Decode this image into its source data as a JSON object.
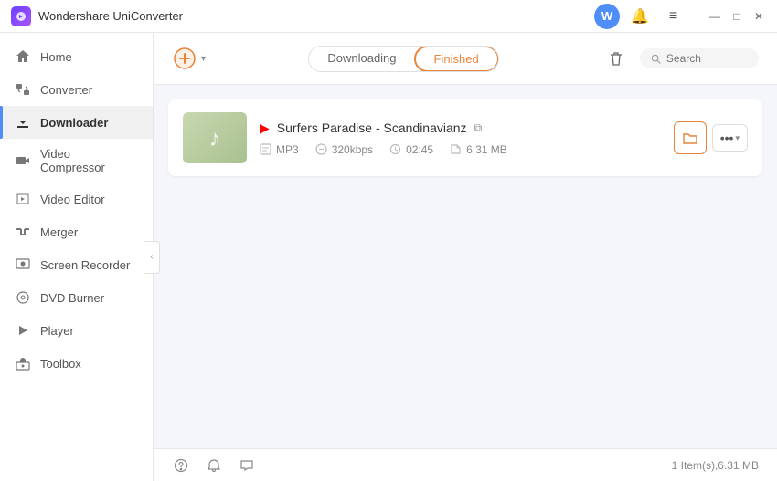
{
  "app": {
    "title": "Wondershare UniConverter"
  },
  "titlebar": {
    "avatar_label": "W",
    "controls": {
      "minimize": "—",
      "maximize": "□",
      "close": "✕"
    }
  },
  "sidebar": {
    "items": [
      {
        "id": "home",
        "label": "Home",
        "active": false
      },
      {
        "id": "converter",
        "label": "Converter",
        "active": false
      },
      {
        "id": "downloader",
        "label": "Downloader",
        "active": true
      },
      {
        "id": "video-compressor",
        "label": "Video Compressor",
        "active": false
      },
      {
        "id": "video-editor",
        "label": "Video Editor",
        "active": false
      },
      {
        "id": "merger",
        "label": "Merger",
        "active": false
      },
      {
        "id": "screen-recorder",
        "label": "Screen Recorder",
        "active": false
      },
      {
        "id": "dvd-burner",
        "label": "DVD Burner",
        "active": false
      },
      {
        "id": "player",
        "label": "Player",
        "active": false
      },
      {
        "id": "toolbox",
        "label": "Toolbox",
        "active": false
      }
    ]
  },
  "header": {
    "add_btn_symbol": "⊕",
    "tabs": [
      {
        "id": "downloading",
        "label": "Downloading",
        "active": false
      },
      {
        "id": "finished",
        "label": "Finished",
        "active": true
      }
    ],
    "search_placeholder": "Search"
  },
  "files": [
    {
      "id": "file-1",
      "thumbnail_icon": "♪",
      "yt_icon": "▶",
      "name": "Surfers Paradise - Scandinavianz",
      "format": "MP3",
      "bitrate": "320kbps",
      "duration": "02:45",
      "size": "6.31 MB"
    }
  ],
  "statusbar": {
    "text": "1 Item(s),6.31 MB"
  }
}
